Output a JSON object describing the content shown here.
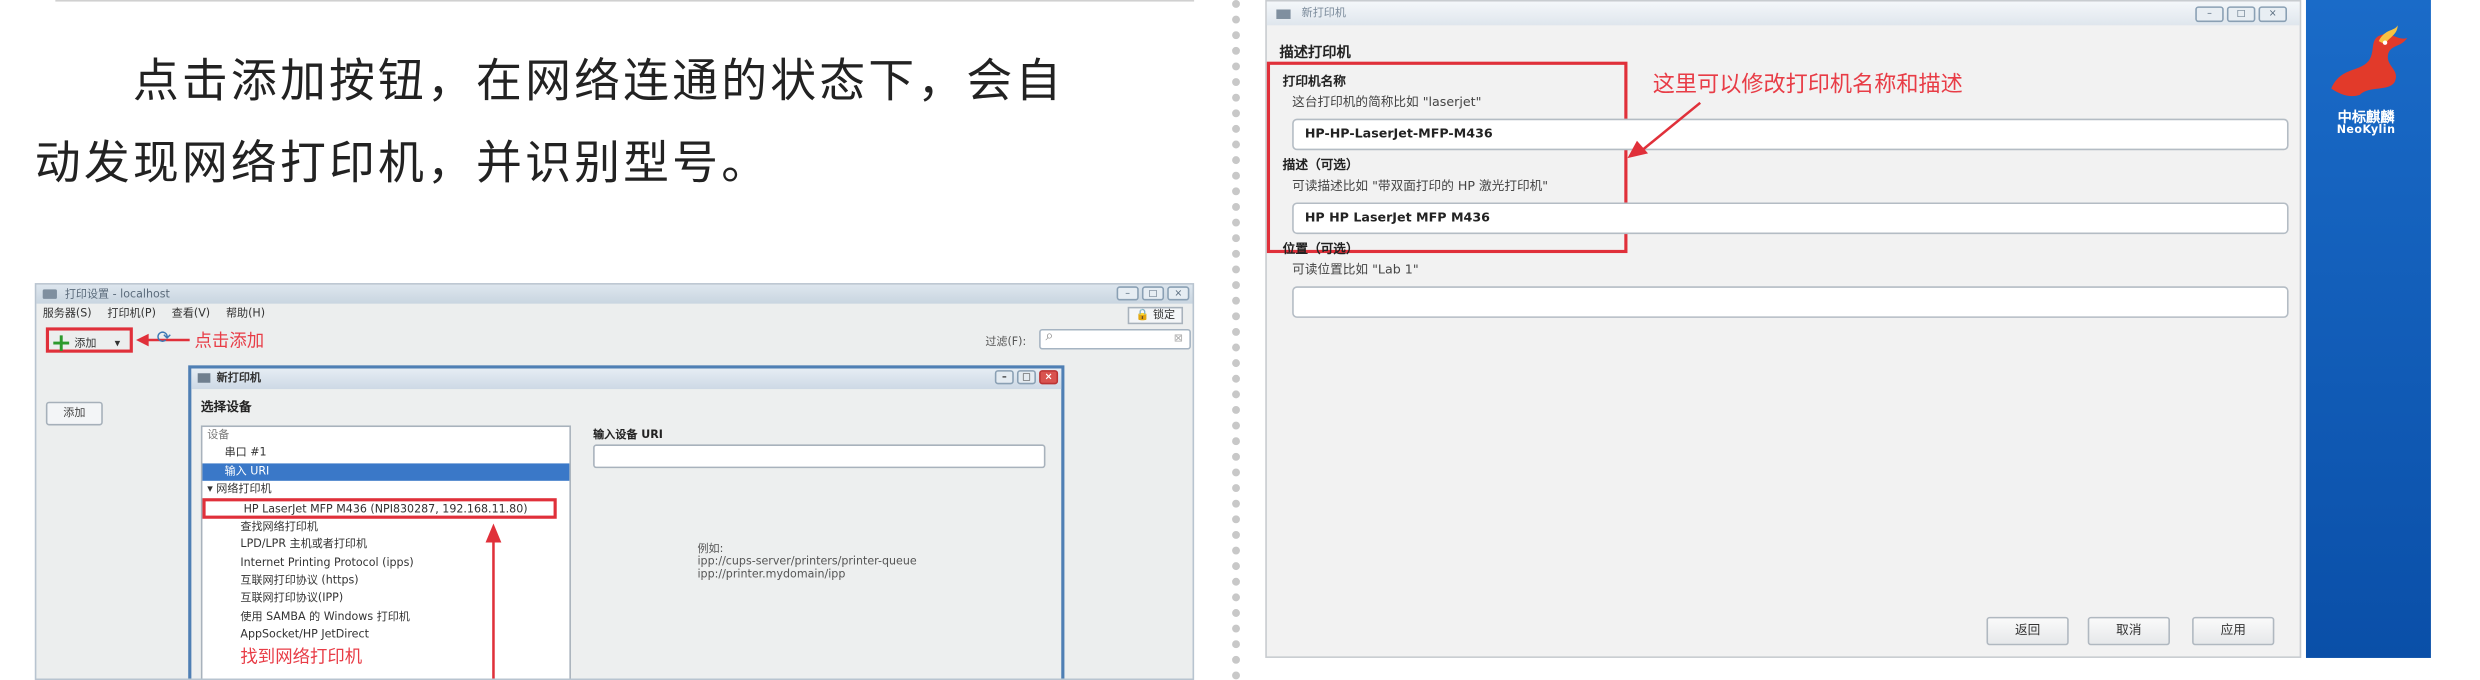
{
  "paragraph": {
    "line1": "点击添加按钮，在网络连通的状态下，会自",
    "line2": "动发现网络打印机，并识别型号。"
  },
  "left_window": {
    "title": "打印设置 - localhost",
    "menu": [
      "服务器(S)",
      "打印机(P)",
      "查看(V)",
      "帮助(H)"
    ],
    "lock": "🔒 锁定",
    "add_label": "添加",
    "filter_label": "过滤(F):",
    "side_add_button": "添加",
    "annotation_add": "点击添加",
    "annotation_found": "找到网络打印机"
  },
  "new_printer_dialog": {
    "title": "新打印机",
    "heading": "选择设备",
    "device_list": {
      "header": "设备",
      "items": [
        "串口 #1",
        "输入 URI",
        "▾ 网络打印机",
        "HP LaserJet MFP M436 (NPI830287, 192.168.11.80)",
        "查找网络打印机",
        "LPD/LPR 主机或者打印机",
        "Internet Printing Protocol (ipps)",
        "互联网打印协议 (https)",
        "互联网打印协议(IPP)",
        "使用 SAMBA 的 Windows 打印机",
        "AppSocket/HP JetDirect"
      ]
    },
    "uri_label": "输入设备 URI",
    "examples": [
      "例如:",
      "ipp://cups-server/printers/printer-queue",
      "ipp://printer.mydomain/ipp"
    ]
  },
  "right_window": {
    "title": "新打印机",
    "heading": "描述打印机",
    "printer_name_label": "打印机名称",
    "printer_name_hint": "这台打印机的简称比如 \"laserjet\"",
    "printer_name_value": "HP-HP-LaserJet-MFP-M436",
    "description_label": "描述（可选）",
    "description_hint": "可读描述比如 \"带双面打印的 HP 激光打印机\"",
    "description_value": "HP HP LaserJet MFP M436",
    "location_label": "位置（可选）",
    "location_hint": "可读位置比如 \"Lab 1\"",
    "location_value": "",
    "annotation": "这里可以修改打印机名称和描述",
    "buttons": {
      "back": "返回",
      "cancel": "取消",
      "apply": "应用"
    }
  },
  "logo": {
    "text_cn": "中标麒麟",
    "text_en": "NeoKylin"
  },
  "colors": {
    "annotation_red": "#e0303a",
    "panel_blue": "#0a4fa8",
    "selection_blue": "#3a78c8"
  }
}
